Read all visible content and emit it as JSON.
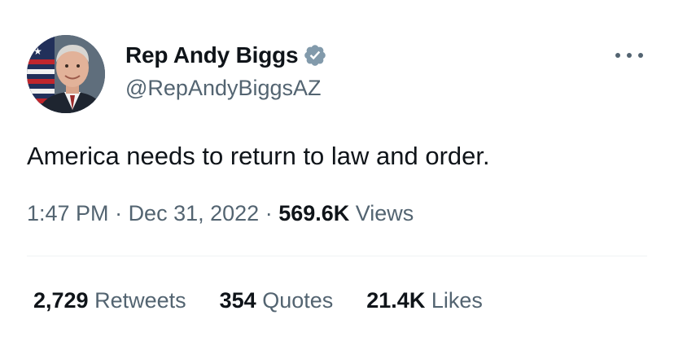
{
  "author": {
    "display_name": "Rep Andy Biggs",
    "handle": "@RepAndyBiggsAZ",
    "verified_icon": "verified-badge-icon",
    "verified_color": "#829aab"
  },
  "tweet": {
    "text": "America needs to return to law and order."
  },
  "meta": {
    "time": "1:47 PM",
    "sep1": " · ",
    "date": "Dec 31, 2022",
    "sep2": " · ",
    "views_count": "569.6K",
    "views_label": " Views"
  },
  "stats": {
    "retweets_count": "2,729",
    "retweets_label": " Retweets",
    "quotes_count": "354",
    "quotes_label": " Quotes",
    "likes_count": "21.4K",
    "likes_label": " Likes"
  },
  "menu": {
    "icon": "more-icon"
  },
  "colors": {
    "text_primary": "#0f1419",
    "text_secondary": "#536471",
    "divider": "#eff3f4"
  }
}
